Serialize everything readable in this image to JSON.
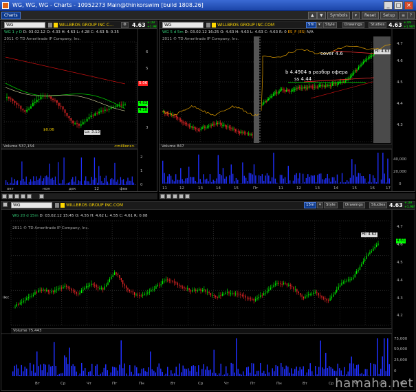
{
  "window": {
    "title": "WG, WG, WG - Charts - 10952273 Main@thinkorswim [build 1808.26]"
  },
  "toolbar": {
    "tab": "Charts",
    "symbols": "Symbols",
    "reset": "Reset",
    "setup": "Setup"
  },
  "panel1": {
    "symbol": "WG",
    "desc": "WILLBROS GROUP INC C…",
    "price": "4.63",
    "change": "+.09 +1.98%",
    "info": {
      "period": "WG 1 y D",
      "d": "D: 03.02.12",
      "o": "O: 4.33",
      "h": "H: 4.63",
      "l": "L: 4.28",
      "c": "C: 4.63",
      "r": "R: 0.35"
    },
    "copyright": "2011 © TD Ameritrade IP Company, Inc.",
    "volume_label": "Volume",
    "volume_value": "537,154",
    "volume_unit": "<millions>",
    "price_tags": [
      "5.06",
      "4.63",
      "4.18"
    ],
    "low_label": "Lo: 3.13",
    "low_left": "$0.06",
    "y_ticks": [
      "6",
      "5",
      "4",
      "3"
    ],
    "vol_ticks": [
      "2",
      "1",
      "0"
    ],
    "x_ticks": [
      "окт",
      "ноя",
      "дек",
      "12",
      "фев"
    ]
  },
  "panel2": {
    "symbol": "WG",
    "desc": "WILLBROS GROUP INC.COM",
    "period_btn": "5m",
    "style": "Style",
    "drawings": "Drawings",
    "studies": "Studies",
    "price": "4.63",
    "change": "+.09 +1.98%",
    "info": {
      "period": "WG 5 d 5m",
      "d": "D: 03.02.12 16:25",
      "o": "O: 4.63",
      "h": "H: 4.63",
      "l": "L: 4.63",
      "c": "C: 4.63",
      "r": "R: 0",
      "es": "ES_F (ES)",
      "na": "N/A"
    },
    "copyright": "2011 © TD Ameritrade IP Company, Inc.",
    "volume_label": "Volume",
    "volume_value": "847",
    "hi_label": "Hi: 4.63",
    "annotations": [
      "cover 4.6",
      "b 4.4904 в разбор офера",
      "ss 4.44"
    ],
    "y_ticks": [
      "4.7",
      "4.6",
      "4.5",
      "4.4",
      "4.3"
    ],
    "vol_ticks": [
      "40,000",
      "20,000",
      "0"
    ],
    "x_ticks": [
      "11",
      "12",
      "13",
      "14",
      "15",
      "Пт",
      "11",
      "12",
      "13",
      "14",
      "15",
      "16",
      "17"
    ]
  },
  "panel3": {
    "symbol": "WG",
    "desc": "WILLBROS GROUP INC.COM",
    "period_btn": "15m",
    "style": "Style",
    "drawings": "Drawings",
    "studies": "Studies",
    "price": "4.63",
    "change": "+.09 +1.98%",
    "info": {
      "period": "WG 20 d 15m",
      "d": "D: 03.02.12 15:45",
      "o": "O: 4.55",
      "h": "H: 4.62",
      "l": "L: 4.55",
      "c": "C: 4.61",
      "r": "R: 0.08"
    },
    "copyright": "2011 © TD Ameritrade IP Company, Inc.",
    "side_label": "іікс",
    "hi_label": "Hi: 4.62",
    "last_tag": "4.61",
    "volume_label": "Volume",
    "volume_value": "75,443",
    "y_ticks": [
      "4.7",
      "4.6",
      "4.5",
      "4.4",
      "4.3",
      "4.2"
    ],
    "vol_ticks": [
      "75,000",
      "50,000",
      "25,000",
      "0"
    ],
    "x_ticks": [
      "Вт",
      "Ср",
      "Чт",
      "Пт",
      "Пн",
      "Вт",
      "Ср",
      "Чт",
      "Пт",
      "Пн",
      "Вт",
      "Ср",
      "Чт",
      "Пт",
      "Пн"
    ]
  },
  "watermark": "hamaha.net",
  "colors": {
    "green": "#00ff00",
    "red": "#ff2020",
    "yellow": "#ffd800",
    "blue": "#2030ff",
    "orange": "#ffa500"
  }
}
